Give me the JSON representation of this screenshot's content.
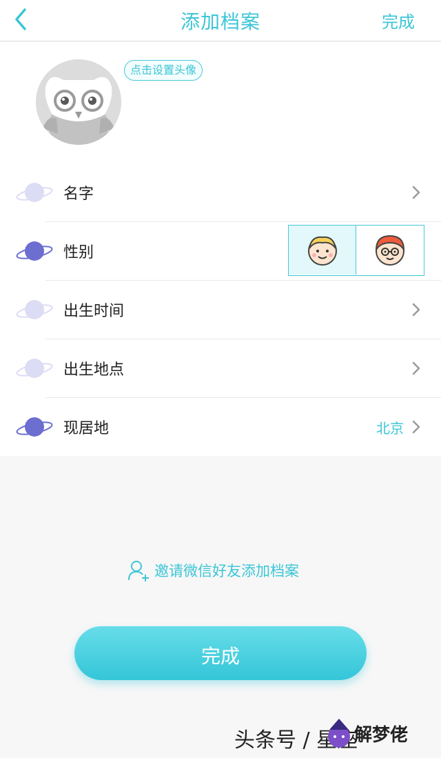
{
  "nav": {
    "title": "添加档案",
    "done_label": "完成"
  },
  "avatar": {
    "tip": "点击设置头像"
  },
  "rows": [
    {
      "label": "名字",
      "value": ""
    },
    {
      "label": "性别",
      "value": ""
    },
    {
      "label": "出生时间",
      "value": ""
    },
    {
      "label": "出生地点",
      "value": ""
    },
    {
      "label": "现居地",
      "value": "北京"
    }
  ],
  "gender": {
    "selected": "female"
  },
  "invite": {
    "label": "邀请微信好友添加档案"
  },
  "footer": {
    "button_label": "完成"
  },
  "watermark": {
    "text": "头条号 / 星座",
    "logo_text": "解梦佬"
  },
  "colors": {
    "accent": "#3cc6d6",
    "planet_active": "#6c6fd0",
    "planet_inactive": "#dcdcf4"
  }
}
